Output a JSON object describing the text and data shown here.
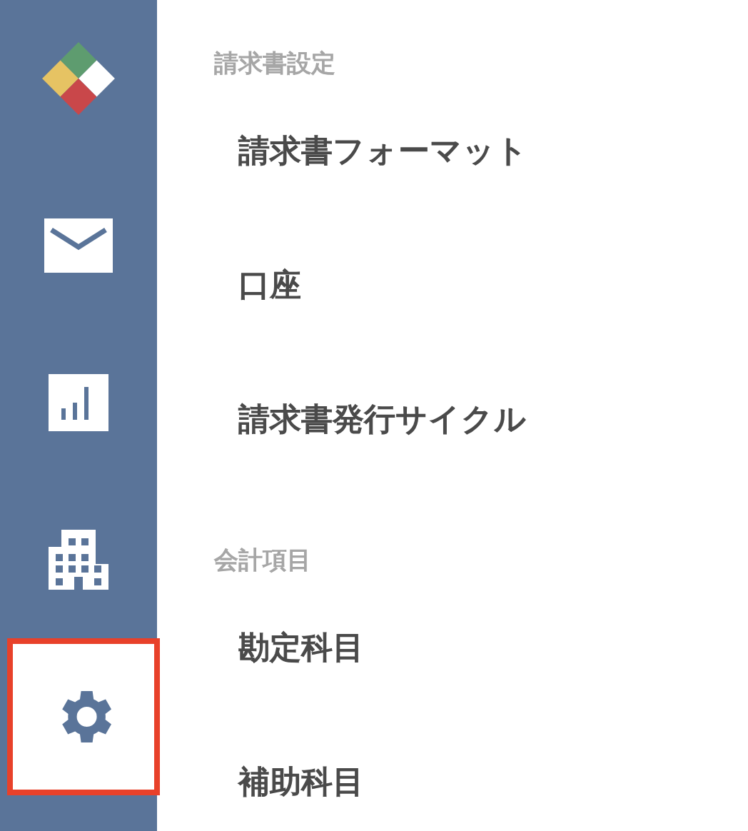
{
  "sidebar": {
    "items": [
      {
        "kind": "mail",
        "selected": false
      },
      {
        "kind": "chart",
        "selected": false
      },
      {
        "kind": "building",
        "selected": false
      },
      {
        "kind": "settings",
        "selected": true
      }
    ]
  },
  "sections": [
    {
      "title": "請求書設定",
      "items": [
        "請求書フォーマット",
        "口座",
        "請求書発行サイクル"
      ]
    },
    {
      "title": "会計項目",
      "items": [
        "勘定科目",
        "補助科目"
      ]
    }
  ]
}
